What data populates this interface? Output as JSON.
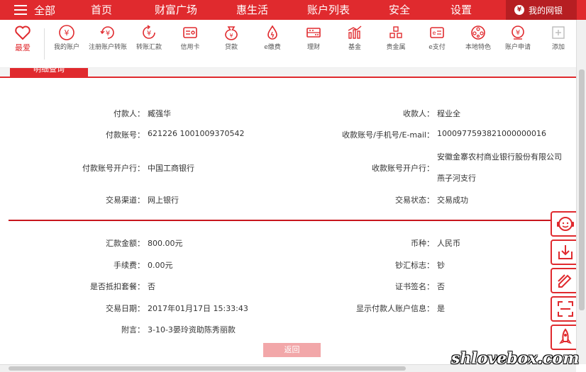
{
  "colors": {
    "brand": "#e02a2e",
    "brand_dark": "#b61e22",
    "divider": "#c8161d",
    "button_disabled": "#f2a7a9"
  },
  "topnav": {
    "menu_label": "全部",
    "items": [
      "首页",
      "财富广场",
      "惠生活",
      "账户列表",
      "安全",
      "设置"
    ],
    "mybank": "我的网银"
  },
  "iconbar": {
    "favorite": "最爱",
    "items": [
      {
        "label": "我的账户",
        "icon": "yuan-circle-icon"
      },
      {
        "label": "注册账户转账",
        "icon": "yuan-transfer-icon"
      },
      {
        "label": "转账汇款",
        "icon": "yuan-remit-icon"
      },
      {
        "label": "信用卡",
        "icon": "credit-card-icon"
      },
      {
        "label": "贷款",
        "icon": "money-bag-icon"
      },
      {
        "label": "e缴费",
        "icon": "drop-icon"
      },
      {
        "label": "理财",
        "icon": "abacus-icon"
      },
      {
        "label": "基金",
        "icon": "bar-chart-icon"
      },
      {
        "label": "贵金属",
        "icon": "gold-bars-icon"
      },
      {
        "label": "e支付",
        "icon": "e-pay-icon"
      },
      {
        "label": "本地特色",
        "icon": "film-reel-icon"
      },
      {
        "label": "账户申请",
        "icon": "yuan-apply-icon"
      },
      {
        "label": "添加",
        "icon": "plus-box-icon"
      }
    ]
  },
  "tab": {
    "label": "明细查询"
  },
  "details": {
    "payer_label": "付款人：",
    "payer": "臧强华",
    "payee_label": "收款人：",
    "payee": "程业全",
    "payer_account_label": "付款账号：",
    "payer_account": "621226 1001009370542",
    "payee_account_label": "收款账号/手机号/E-mail：",
    "payee_account": "1000977593821000000016",
    "payer_bank_label": "付款账号开户行：",
    "payer_bank": "中国工商银行",
    "payee_bank_label": "收款账号开户行：",
    "payee_bank_line1": "安徽金寨农村商业银行股份有限公司",
    "payee_bank_line2": "燕子河支行",
    "channel_label": "交易渠道：",
    "channel": "网上银行",
    "status_label": "交易状态：",
    "status": "交易成功",
    "amount_label": "汇款金额：",
    "amount": "800.00元",
    "currency_label": "币种：",
    "currency": "人民币",
    "fee_label": "手续费：",
    "fee": "0.00元",
    "cash_flag_label": "钞汇标志：",
    "cash_flag": "钞",
    "package_label": "是否抵扣套餐：",
    "package": "否",
    "cert_label": "证书签名：",
    "cert": "否",
    "date_label": "交易日期：",
    "date": "2017年01月17日 15:33:43",
    "show_payer_label": "显示付款人账户信息：",
    "show_payer": "是",
    "memo_label": "附言：",
    "memo": "3-10-3晏玲资助陈秀丽款"
  },
  "back_button": "返回",
  "side_tools": [
    "customer-service-icon",
    "download-icon",
    "edit-icon",
    "scan-icon",
    "rocket-icon"
  ],
  "watermark": "shlovebox.com"
}
